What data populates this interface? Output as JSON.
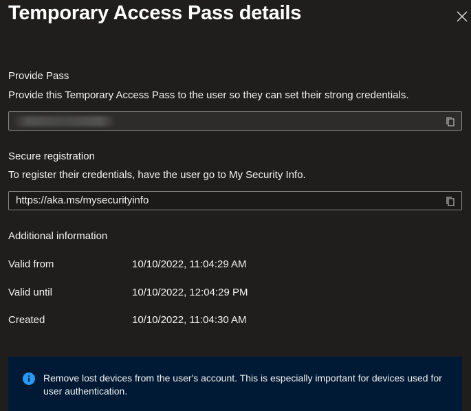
{
  "panel": {
    "title": "Temporary Access Pass details"
  },
  "provide_pass": {
    "label": "Provide Pass",
    "description": "Provide this Temporary Access Pass to the user so they can set their strong credentials."
  },
  "secure_registration": {
    "label": "Secure registration",
    "description": "To register their credentials, have the user go to My Security Info.",
    "url": "https://aka.ms/mysecurityinfo"
  },
  "additional_information": {
    "label": "Additional information",
    "rows": [
      {
        "label": "Valid from",
        "value": "10/10/2022, 11:04:29 AM"
      },
      {
        "label": "Valid until",
        "value": "10/10/2022, 12:04:29 PM"
      },
      {
        "label": "Created",
        "value": "10/10/2022, 11:04:30 AM"
      }
    ]
  },
  "info_banner": {
    "text": "Remove lost devices from the user's account. This is especially important for devices used for user authentication."
  },
  "icons": {
    "close": "close-icon",
    "copy": "copy-icon",
    "info": "info-icon"
  },
  "colors": {
    "background": "#1f1e1d",
    "banner_background": "#001a35",
    "info_accent": "#2899f5",
    "field_border": "#8a8886"
  }
}
